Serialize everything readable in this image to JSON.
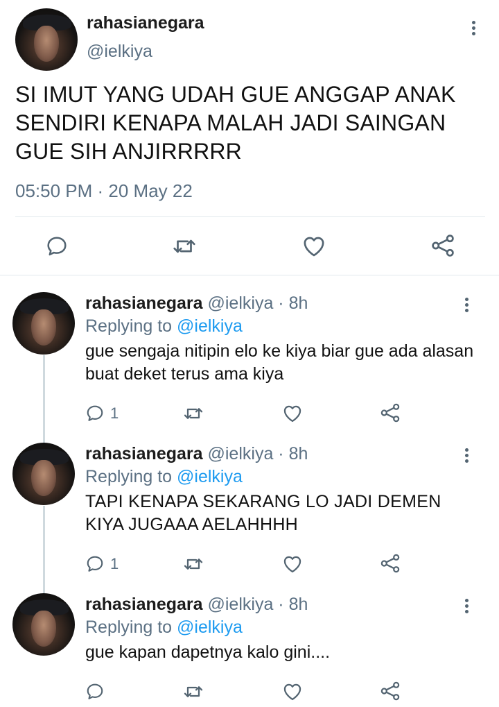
{
  "main_tweet": {
    "name": "rahasianegara",
    "handle": "@ielkiya",
    "text": "SI IMUT YANG UDAH GUE ANGGAP ANAK SENDIRI KENAPA MALAH JADI SAINGAN GUE SIH ANJIRRRRR",
    "timestamp": "05:50 PM · 20 May 22"
  },
  "replies": [
    {
      "name": "rahasianegara",
      "meta": "@ielkiya · 8h",
      "replying_prefix": "Replying to ",
      "replying_to": "@ielkiya",
      "text": "gue sengaja nitipin elo ke kiya biar gue ada alasan buat deket terus ama kiya",
      "reply_count": "1"
    },
    {
      "name": "rahasianegara",
      "meta": "@ielkiya · 8h",
      "replying_prefix": "Replying to ",
      "replying_to": "@ielkiya",
      "text": "TAPI KENAPA SEKARANG LO JADI DEMEN KIYA JUGAAA AELAHHHH",
      "reply_count": "1"
    },
    {
      "name": "rahasianegara",
      "meta": "@ielkiya · 8h",
      "replying_prefix": "Replying to ",
      "replying_to": "@ielkiya",
      "text": "gue kapan dapetnya kalo gini....",
      "reply_count": ""
    }
  ],
  "icons": {
    "reply": "reply-icon",
    "retweet": "retweet-icon",
    "like": "heart-icon",
    "share": "share-icon",
    "more": "more-icon"
  },
  "colors": {
    "mention": "#1d9bf0",
    "secondary_text": "#5b7083",
    "icon": "#536471"
  }
}
